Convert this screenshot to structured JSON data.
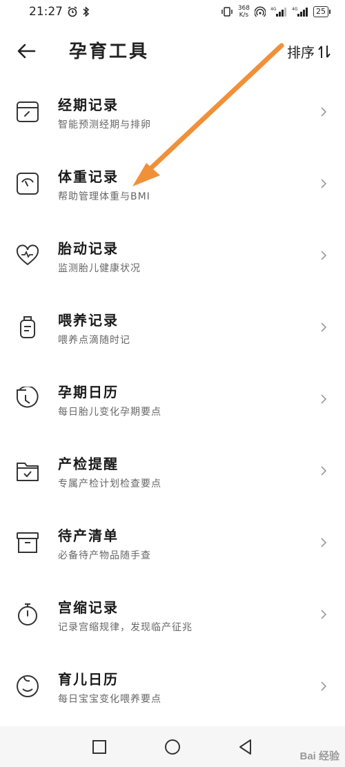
{
  "status_bar": {
    "time": "21:27",
    "speed_value": "368",
    "speed_unit": "K/s",
    "battery": "25"
  },
  "header": {
    "title": "孕育工具",
    "sort_label": "排序"
  },
  "tools": [
    {
      "title": "经期记录",
      "desc": "智能预测经期与排卵",
      "icon": "calendar-icon"
    },
    {
      "title": "体重记录",
      "desc": "帮助管理体重与BMI",
      "icon": "scale-icon"
    },
    {
      "title": "胎动记录",
      "desc": "监测胎儿健康状况",
      "icon": "heart-pulse-icon"
    },
    {
      "title": "喂养记录",
      "desc": "喂养点滴随时记",
      "icon": "bottle-icon"
    },
    {
      "title": "孕期日历",
      "desc": "每日胎儿变化孕期要点",
      "icon": "clock-icon"
    },
    {
      "title": "产检提醒",
      "desc": "专属产检计划检查要点",
      "icon": "folder-check-icon"
    },
    {
      "title": "待产清单",
      "desc": "必备待产物品随手查",
      "icon": "archive-box-icon"
    },
    {
      "title": "宫缩记录",
      "desc": "记录宫缩规律，发现临产征兆",
      "icon": "stopwatch-icon"
    },
    {
      "title": "育儿日历",
      "desc": "每日宝宝变化喂养要点",
      "icon": "baby-face-icon"
    }
  ],
  "accent_color": "#f0913a",
  "watermark": "Bai 经验"
}
